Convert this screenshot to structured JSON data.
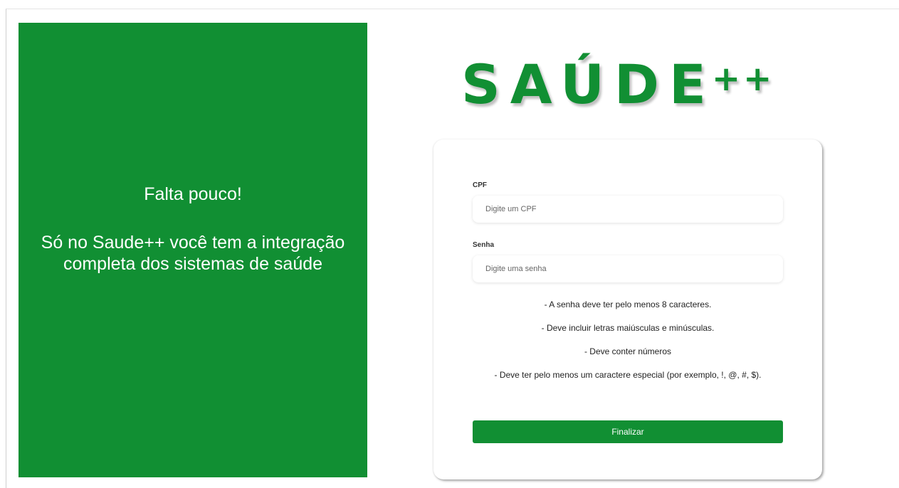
{
  "promo": {
    "heading": "Falta pouco!",
    "tagline": "Só no Saude++ você tem a integração completa dos sistemas de saúde",
    "background_color": "#118f33"
  },
  "logo": {
    "word": "SAÚDE",
    "suffix": "++",
    "color": "#118f33"
  },
  "form": {
    "cpf_label": "CPF",
    "cpf_placeholder": "Digite um CPF",
    "cpf_value": "",
    "password_label": "Senha",
    "password_placeholder": "Digite uma senha",
    "password_value": "",
    "rules": [
      "- A senha deve ter pelo menos 8 caracteres.",
      "- Deve incluir letras maiúsculas e minúsculas.",
      "- Deve conter números",
      "- Deve ter pelo menos um caractere especial (por exemplo, !, @, #, $)."
    ],
    "submit_label": "Finalizar"
  }
}
